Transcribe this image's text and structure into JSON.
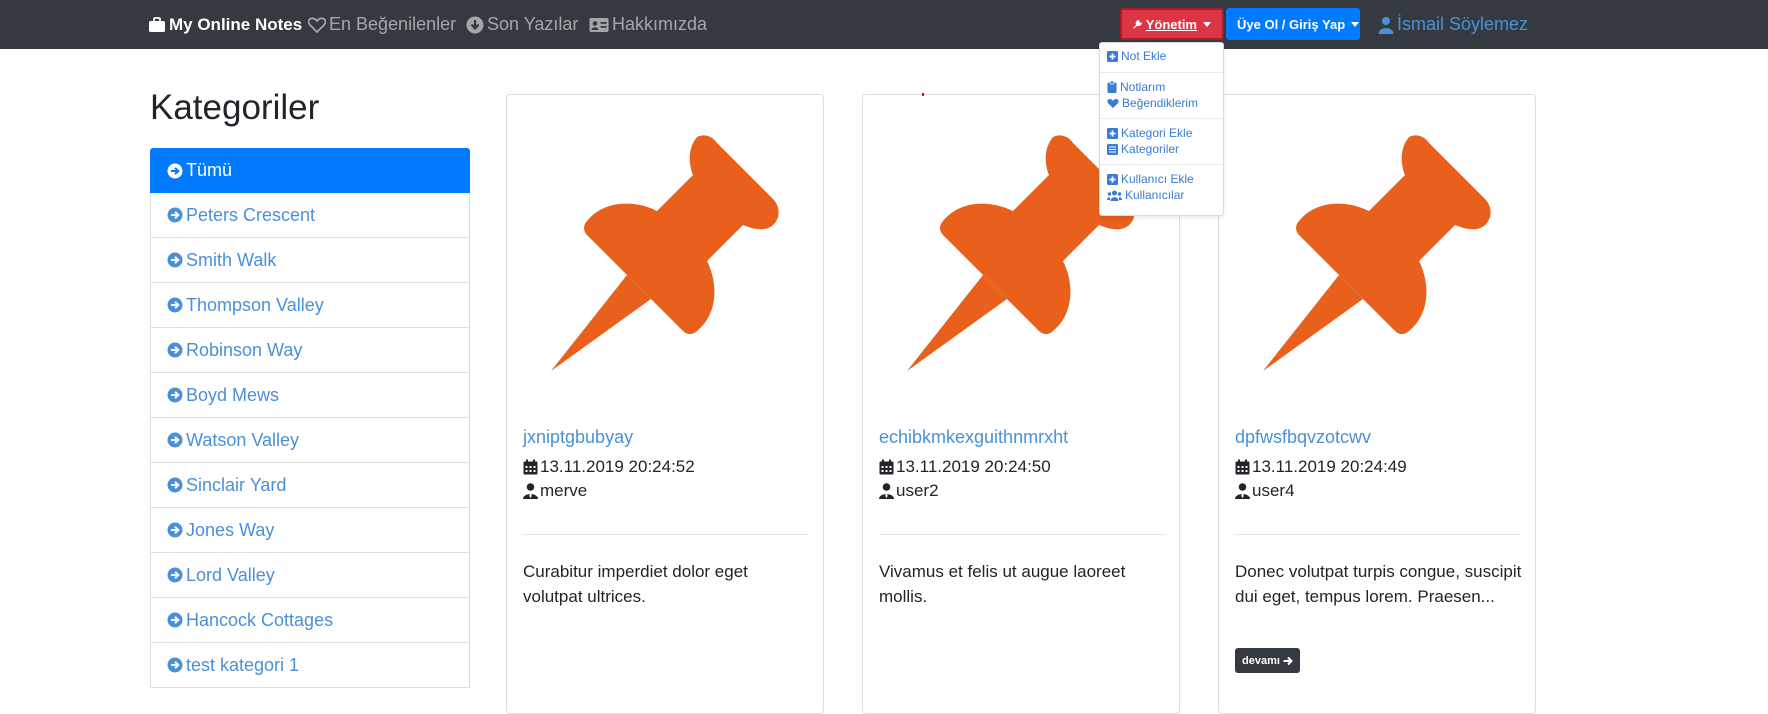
{
  "navbar": {
    "brand": "My Online Notes",
    "links": [
      {
        "label": "En Beğenilenler",
        "icon": "heart-outline-icon"
      },
      {
        "label": "Son Yazılar",
        "icon": "arrow-circle-down-icon"
      },
      {
        "label": "Hakkımızda",
        "icon": "id-card-icon"
      }
    ],
    "admin_label": "Yönetim",
    "login_label": "Üye Ol / Giriş Yap",
    "user_name": "İsmail Söylemez"
  },
  "admin_menu": [
    {
      "label": "Not Ekle",
      "icon": "plus-square-icon"
    },
    {
      "label": "Notlarım",
      "icon": "clipboard-icon"
    },
    {
      "label": "Beğendiklerim",
      "icon": "heart-icon"
    },
    {
      "label": "Kategori Ekle",
      "icon": "plus-square-icon"
    },
    {
      "label": "Kategoriler",
      "icon": "list-icon"
    },
    {
      "label": "Kullanıcı Ekle",
      "icon": "plus-square-icon"
    },
    {
      "label": "Kullanıcılar",
      "icon": "users-icon"
    }
  ],
  "sidebar": {
    "title": "Kategoriler",
    "items": [
      "Tümü",
      "Peters Crescent",
      "Smith Walk",
      "Thompson Valley",
      "Robinson Way",
      "Boyd Mews",
      "Watson Valley",
      "Sinclair Yard",
      "Jones Way",
      "Lord Valley",
      "Hancock Cottages",
      "test kategori 1"
    ],
    "active_index": 0
  },
  "cards": [
    {
      "title": "jxniptgbubyay",
      "date": "13.11.2019 20:24:52",
      "user": "merve",
      "text": "Curabitur imperdiet dolor eget volutpat ultrices.",
      "more": ""
    },
    {
      "title": "echibkmkexguithnmrxht",
      "date": "13.11.2019 20:24:50",
      "user": "user2",
      "text": "Vivamus et felis ut augue laoreet mollis.",
      "more": ""
    },
    {
      "title": "dpfwsfbqvzotcwv",
      "date": "13.11.2019 20:24:49",
      "user": "user4",
      "text": "Donec volutpat turpis congue, suscipit dui eget, tempus lorem. Praesen...",
      "more": "devamı"
    }
  ],
  "colors": {
    "navbar": "#343a40",
    "primary": "#007bff",
    "danger": "#dc3545",
    "pin": "#e8601c",
    "link": "#4a90d9"
  }
}
